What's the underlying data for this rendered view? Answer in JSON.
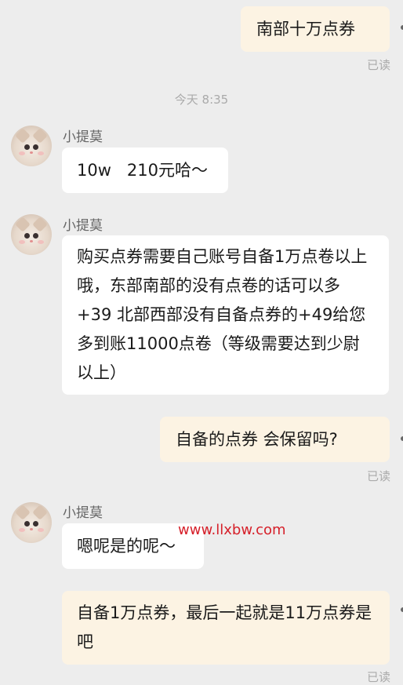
{
  "messages": [
    {
      "side": "right",
      "text": "南部十万点券",
      "read": "已读"
    },
    {
      "side": "left",
      "sender": "小提莫",
      "text": "10w   210元哈～"
    },
    {
      "side": "left",
      "sender": "小提莫",
      "text": "购买点券需要自己账号自备1万点卷以上哦，东部南部的没有点卷的话可以多+39  北部西部没有自备点券的+49给您多到账11000点卷（等级需要达到少尉以上）"
    },
    {
      "side": "right",
      "text": "自备的点券 会保留吗?",
      "read": "已读"
    },
    {
      "side": "left",
      "sender": "小提莫",
      "text": "嗯呢是的呢～"
    },
    {
      "side": "right",
      "text": "自备1万点券，最后一起就是11万点券是吧",
      "read": "已读"
    }
  ],
  "timestamp": "今天 8:35",
  "watermark": "www.llxbw.com",
  "colors": {
    "background": "#ededed",
    "outgoing_bubble": "#fcf3e3",
    "incoming_bubble": "#ffffff",
    "watermark": "#d6202a"
  },
  "icons": {
    "avatar": "cat-avatar"
  }
}
